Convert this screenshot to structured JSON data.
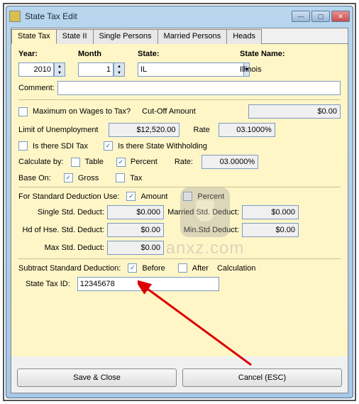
{
  "window": {
    "title": "State Tax Edit"
  },
  "tabs": [
    "State Tax",
    "State II",
    "Single Persons",
    "Married Persons",
    "Heads"
  ],
  "headers": {
    "year": "Year:",
    "month": "Month",
    "state": "State:",
    "statename": "State Name:"
  },
  "values": {
    "year": "2010",
    "month": "1",
    "state": "IL",
    "statename": "Illinois"
  },
  "labels": {
    "comment": "Comment:",
    "maxwages": "Maximum on Wages to Tax?",
    "cutoff": "Cut-Off Amount",
    "limitunemp": "Limit of Unemployment",
    "rate": "Rate",
    "sdi": "Is there SDI Tax",
    "withholding": "Is there State Withholding",
    "calcby": "Calculate by:",
    "table": "Table",
    "percent": "Percent",
    "rate2": "Rate:",
    "baseon": "Base On:",
    "gross": "Gross",
    "tax": "Tax",
    "stddeduct": "For Standard Deduction Use:",
    "amount": "Amount",
    "percent2": "Percent",
    "single": "Single Std. Deduct:",
    "married": "Married Std. Deduct:",
    "hd": "Hd of Hse. Std. Deduct:",
    "min": "Min.Std Deduct:",
    "max": "Max Std. Deduct:",
    "subtract": "Subtract Standard Deduction:",
    "before": "Before",
    "after": "After",
    "calculation": "Calculation",
    "taxid": "State Tax ID:"
  },
  "fields": {
    "cutoff": "$0.00",
    "limitunemp": "$12,520.00",
    "rate1": "03.1000%",
    "rate2": "03.0000%",
    "single": "$0.000",
    "married": "$0.000",
    "hd": "$0.00",
    "min": "$0.00",
    "max": "$0.00",
    "taxid": "12345678"
  },
  "checks": {
    "maxwages": false,
    "sdi": false,
    "withholding": true,
    "table": false,
    "percent": true,
    "gross": true,
    "tax": false,
    "amount": true,
    "percent2": false,
    "before": true,
    "after": false
  },
  "buttons": {
    "save": "Save & Close",
    "cancel": "Cancel (ESC)"
  },
  "watermark": "anxz.com"
}
